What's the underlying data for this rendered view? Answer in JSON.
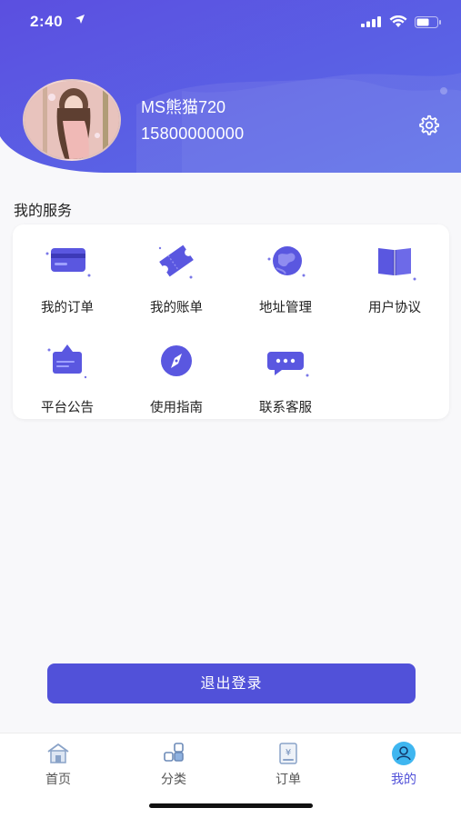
{
  "status_bar": {
    "time": "2:40"
  },
  "profile": {
    "username": "MS熊猫720",
    "phone": "15800000000"
  },
  "services": {
    "title": "我的服务",
    "items": [
      {
        "label": "我的订单",
        "icon": "card-icon"
      },
      {
        "label": "我的账单",
        "icon": "ticket-icon"
      },
      {
        "label": "地址管理",
        "icon": "globe-icon"
      },
      {
        "label": "用户协议",
        "icon": "book-icon"
      },
      {
        "label": "平台公告",
        "icon": "announcement-icon"
      },
      {
        "label": "使用指南",
        "icon": "compass-icon"
      },
      {
        "label": "联系客服",
        "icon": "chat-icon"
      }
    ]
  },
  "logout": {
    "label": "退出登录"
  },
  "tabbar": {
    "tabs": [
      {
        "label": "首页",
        "icon": "home-icon"
      },
      {
        "label": "分类",
        "icon": "category-icon"
      },
      {
        "label": "订单",
        "icon": "order-icon"
      },
      {
        "label": "我的",
        "icon": "profile-icon"
      }
    ],
    "active_index": 3
  },
  "colors": {
    "primary": "#5151d9",
    "header_gradient_start": "#5b4fe0",
    "header_gradient_end": "#5a6de8"
  }
}
